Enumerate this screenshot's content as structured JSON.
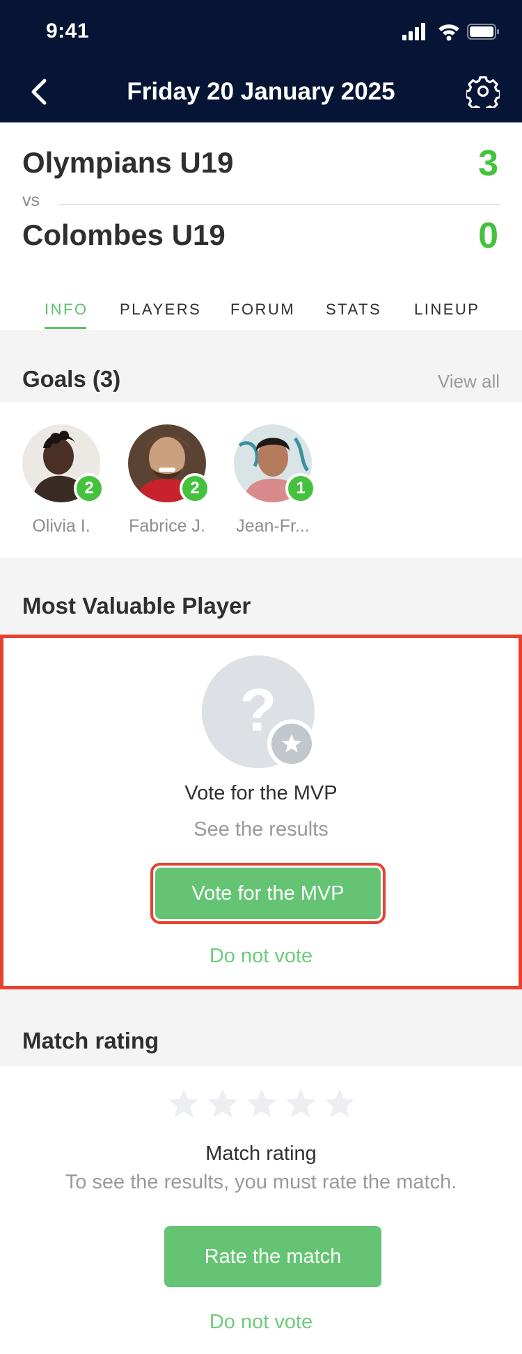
{
  "status_bar": {
    "time": "9:41"
  },
  "nav": {
    "title": "Friday 20 January 2025",
    "back_icon": "chevron-left-icon",
    "settings_icon": "gear-icon"
  },
  "match": {
    "home_team": "Olympians U19",
    "home_score": "3",
    "vs_label": "vs",
    "away_team": "Colombes U19",
    "away_score": "0"
  },
  "tabs": [
    {
      "label": "INFO",
      "active": true
    },
    {
      "label": "PLAYERS",
      "active": false
    },
    {
      "label": "FORUM",
      "active": false
    },
    {
      "label": "STATS",
      "active": false
    },
    {
      "label": "LINEUP",
      "active": false
    }
  ],
  "goals": {
    "title": "Goals (3)",
    "view_all": "View all",
    "scorers": [
      {
        "name": "Olivia I.",
        "goals": "2"
      },
      {
        "name": "Fabrice J.",
        "goals": "2"
      },
      {
        "name": "Jean-Fr...",
        "goals": "1"
      }
    ]
  },
  "mvp": {
    "section_title": "Most Valuable Player",
    "placeholder_glyph": "?",
    "title": "Vote for the MVP",
    "subtitle": "See the results",
    "vote_button": "Vote for the MVP",
    "skip_link": "Do not vote"
  },
  "rating": {
    "section_title": "Match rating",
    "stars_filled": 0,
    "stars_total": 5,
    "title": "Match rating",
    "subtitle": "To see the results, you must rate the match.",
    "rate_button": "Rate the match",
    "skip_link": "Do not vote"
  },
  "colors": {
    "header_bg": "#061436",
    "accent_green": "#44c23d",
    "button_green": "#64c474",
    "highlight_red": "#e8412f"
  }
}
